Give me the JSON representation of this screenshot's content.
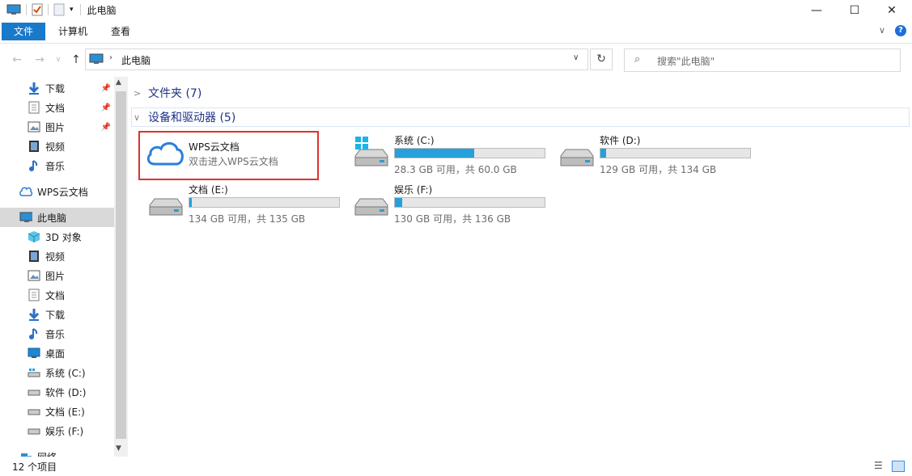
{
  "window": {
    "title": "此电脑"
  },
  "ribbon": {
    "tabs": [
      "文件",
      "计算机",
      "查看"
    ]
  },
  "address": {
    "location": "此电脑",
    "search_placeholder": "搜索\"此电脑\""
  },
  "nav": {
    "quick_access": [
      {
        "label": "下载",
        "icon": "download-icon",
        "pinned": true
      },
      {
        "label": "文档",
        "icon": "document-icon",
        "pinned": true
      },
      {
        "label": "图片",
        "icon": "pictures-icon",
        "pinned": true
      },
      {
        "label": "视频",
        "icon": "video-icon",
        "pinned": false
      },
      {
        "label": "音乐",
        "icon": "music-icon",
        "pinned": false
      }
    ],
    "wps": "WPS云文档",
    "this_pc": "此电脑",
    "pc_items": [
      {
        "label": "3D 对象",
        "icon": "3d-objects-icon"
      },
      {
        "label": "视频",
        "icon": "video-icon"
      },
      {
        "label": "图片",
        "icon": "pictures-icon"
      },
      {
        "label": "文档",
        "icon": "document-icon"
      },
      {
        "label": "下载",
        "icon": "download-icon"
      },
      {
        "label": "音乐",
        "icon": "music-icon"
      },
      {
        "label": "桌面",
        "icon": "desktop-icon"
      },
      {
        "label": "系统 (C:)",
        "icon": "system-drive-icon"
      },
      {
        "label": "软件 (D:)",
        "icon": "drive-icon"
      },
      {
        "label": "文档 (E:)",
        "icon": "drive-icon"
      },
      {
        "label": "娱乐 (F:)",
        "icon": "drive-icon"
      }
    ],
    "network": "网络"
  },
  "content": {
    "folders_header": "文件夹 (7)",
    "devices_header": "设备和驱动器 (5)",
    "wps_tile": {
      "title": "WPS云文档",
      "subtitle": "双击进入WPS云文档"
    },
    "drives": [
      {
        "name": "系统 (C:)",
        "free": "28.3 GB 可用，共 60.0 GB",
        "used_fraction": 0.53,
        "type": "system"
      },
      {
        "name": "软件 (D:)",
        "free": "129 GB 可用，共 134 GB",
        "used_fraction": 0.04,
        "type": "hdd"
      },
      {
        "name": "文档 (E:)",
        "free": "134 GB 可用，共 135 GB",
        "used_fraction": 0.007,
        "type": "hdd"
      },
      {
        "name": "娱乐 (F:)",
        "free": "130 GB 可用，共 136 GB",
        "used_fraction": 0.05,
        "type": "hdd"
      }
    ]
  },
  "status": {
    "count": "12 个项目"
  },
  "colors": {
    "accent": "#1979ca",
    "bar_fill": "#26a0da",
    "highlight_border": "#e0312c"
  }
}
